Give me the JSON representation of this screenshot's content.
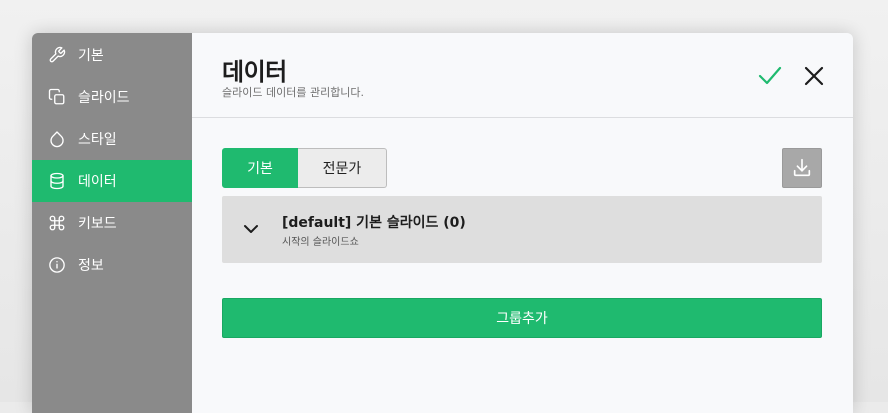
{
  "sidebar": {
    "items": [
      {
        "label": "기본",
        "icon": "wrench-icon"
      },
      {
        "label": "슬라이드",
        "icon": "copy-icon"
      },
      {
        "label": "스타일",
        "icon": "droplet-icon"
      },
      {
        "label": "데이터",
        "icon": "database-icon",
        "active": true
      },
      {
        "label": "키보드",
        "icon": "command-icon"
      },
      {
        "label": "정보",
        "icon": "info-icon"
      }
    ]
  },
  "header": {
    "title": "데이터",
    "subtitle": "슬라이드 데이터를 관리합니다."
  },
  "tabs": [
    {
      "label": "기본",
      "active": true
    },
    {
      "label": "전문가",
      "active": false
    }
  ],
  "group": {
    "title": "[default] 기본 슬라이드 (0)",
    "description": "시작의 슬라이드쇼"
  },
  "actions": {
    "add_group_label": "그룹추가"
  },
  "colors": {
    "accent": "#1fba6f",
    "sidebar": "#8a8a8a",
    "panel": "#dedede"
  }
}
